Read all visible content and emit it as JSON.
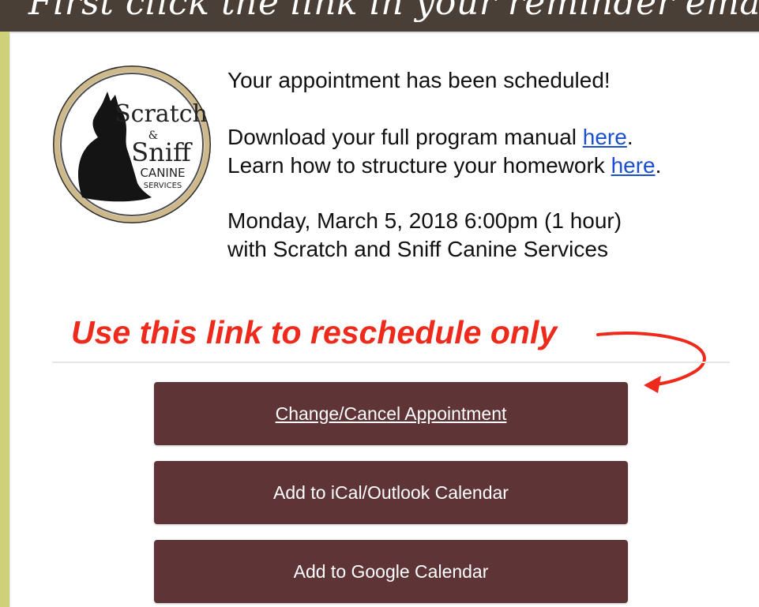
{
  "header": {
    "title": "First click the link in your reminder email"
  },
  "logo": {
    "line1": "Scratch",
    "amp": "&",
    "line2": "Sniff",
    "line3": "CANINE",
    "line4": "SERVICES"
  },
  "email": {
    "scheduled_message": "Your appointment has been scheduled!",
    "manual_text": "Download your full program manual ",
    "manual_link": "here",
    "homework_text": "Learn how to structure your homework ",
    "homework_link": "here",
    "period": ".",
    "date_time": "Monday, March 5, 2018 6:00pm (1 hour)",
    "with_provider": "with Scratch and Sniff Canine Services"
  },
  "annotation": {
    "note": "Use this link to reschedule only"
  },
  "buttons": {
    "change_cancel": "Change/Cancel Appointment",
    "ical_outlook": "Add to iCal/Outlook Calendar",
    "google": "Add to Google Calendar"
  },
  "colors": {
    "header_bg": "#4a3f37",
    "stripe": "#cfd07a",
    "button_bg": "#5e3437",
    "link": "#1a4fd0",
    "annotation_red": "#ee2a1c"
  }
}
